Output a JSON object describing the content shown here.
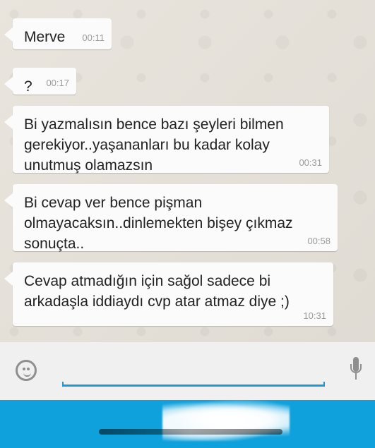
{
  "conversation": {
    "messages": [
      {
        "text": "Merve",
        "time": "00:11"
      },
      {
        "text": "?",
        "time": "00:17"
      },
      {
        "text": "Bi yazmalısın bence bazı şeyleri bilmen\ngerekiyor..yaşananları bu kadar kolay\nunutmuş olamazsın",
        "time": "00:31"
      },
      {
        "text": "Bi cevap ver bence pişman\nolmayacaksın..dinlemekten bişey çıkmaz\nsonuçta..",
        "time": "00:58"
      },
      {
        "text": "Cevap atmadığın için sağol sadece bi\narkadaşla iddiaydı cvp atar atmaz diye ;)",
        "time": "10:31"
      }
    ]
  },
  "input_bar": {
    "emoji_icon": "emoji-icon",
    "mic_icon": "microphone-icon"
  },
  "colors": {
    "chat_background": "#e7e2da",
    "bubble": "#fbfbfb",
    "accent": "#1a9ad6",
    "bottom_bar": "#0ea1dc"
  }
}
